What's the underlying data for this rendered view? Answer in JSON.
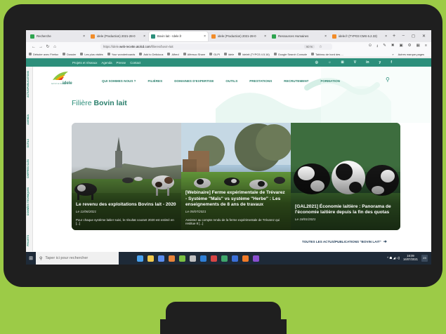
{
  "browser": {
    "tabs": [
      {
        "label": "Recherche",
        "color": "#2ea44f",
        "active": false
      },
      {
        "label": "idele (Production) 2021-28-0",
        "color": "#f28c28",
        "active": false
      },
      {
        "label": "Bovin lait - Idele.fr",
        "color": "#2d8f7b",
        "active": true
      },
      {
        "label": "idele (Production) 2021-28-0",
        "color": "#f28c28",
        "active": false
      },
      {
        "label": "Ressources Humaines",
        "color": "#2ea44f",
        "active": false
      },
      {
        "label": "idele.fr (TYPO3 CMS 6.2.33)",
        "color": "#f28c28",
        "active": false
      }
    ],
    "new_tab": "+",
    "window_controls": [
      "–",
      "◻",
      "✕"
    ],
    "url_prefix": "https://idele.",
    "url_domain": "web-recette.atolcd.com",
    "url_suffix": "/filieres/bovin-lait",
    "zoom": "90 %",
    "bookmarks": [
      "Débuter avec Firefox",
      "Dossier",
      "Les plus visités",
      "Your wonderboards",
      "Add to Delicious",
      "Alfred",
      "Alfresco Share",
      "GLPI",
      "idele",
      "ideleit (TYPO3 4.5.16)",
      "Google Search Console",
      "Tableau de bord des ..."
    ],
    "bookmarks_more": "»",
    "other_bookmarks": "Autres marque-pages"
  },
  "site": {
    "topbar_links": [
      "Projets et réseaux",
      "Agenda",
      "Presse",
      "Contact"
    ],
    "social_icons": [
      "◎",
      "☼",
      "⊞",
      "V",
      "in",
      "y",
      "f"
    ],
    "sidebar": [
      "ACTUS/PUBLICATIONS",
      "AGENDA",
      "OUTILS",
      "CHIFFRES CLÉS",
      "DONNÉES TECHNIQUES",
      "PROJETS"
    ],
    "logo_text": "idele",
    "logo_subtext": "INSTITUT DE L'ÉLEVAGE",
    "nav": [
      "QUI SOMMES NOUS ?",
      "FILIÈRES",
      "DOMAINES D'EXPERTISE",
      "OUTILS",
      "PRESTATIONS",
      "RECRUTEMENT",
      "FORMATION"
    ],
    "search_icon": "⚲",
    "heading_prefix": "Filière",
    "heading_strong": "Bovin lait",
    "cards": [
      {
        "title": "Le revenu des exploitations Bovins lait - 2020",
        "date": "Le 11/06/2021",
        "excerpt": "Pour chaque système laitier suivi, le résultat courant 2020 est estimé en [...]"
      },
      {
        "title": "[Webinaire] Ferme expérimentale de Trévarez - Système \"Maïs\" vs système \"Herbe\" : Les enseignements de 8 ans de travaux",
        "date": "Le 05/07/2021",
        "excerpt": "Assistez au compte rendu de la ferme expérimentale de Trévarez qui restitue 8 [...]"
      },
      {
        "title": "[GAL2021] Économie laitière : Panorama de l'économie laitière depuis la fin des quotas",
        "date": "Le 18/01/2021",
        "excerpt": ""
      }
    ],
    "all_news": "TOUTES LES ACTUS/PUBLICATIONS \"BOVIN LAIT\"",
    "all_news_arrow": "➜"
  },
  "taskbar": {
    "search_placeholder": "Taper ici pour rechercher",
    "time": "16:09",
    "date": "16/07/2021",
    "notif": "23",
    "tray_icons": "^ ☗ ◢ ◁)",
    "icon_colors": [
      "#4aa3f0",
      "#f2c94c",
      "#5b8def",
      "#e8833a",
      "#7bc043",
      "#c0c0c0",
      "#2f7fd6",
      "#d64545",
      "#3fa66b",
      "#3a6fd8",
      "#f07a28",
      "#8a4fd0"
    ]
  }
}
